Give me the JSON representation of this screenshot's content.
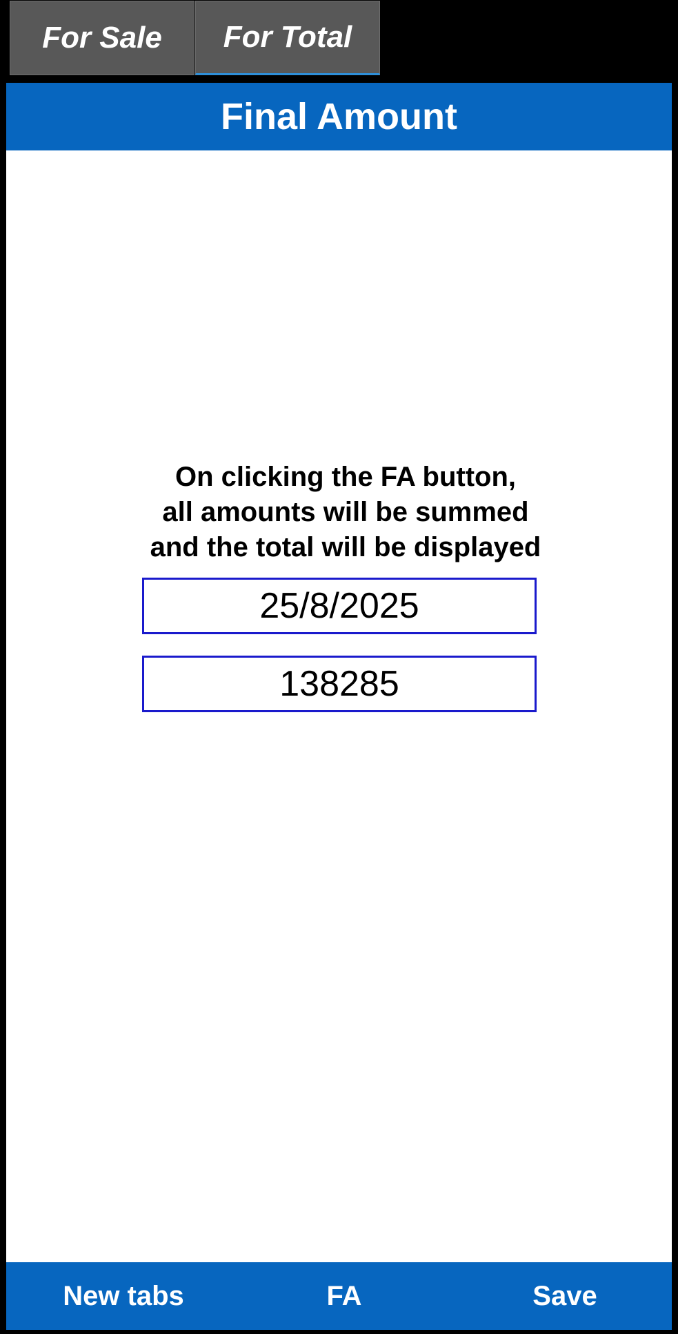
{
  "tabs": [
    {
      "label": "For Sale"
    },
    {
      "label": "For Total"
    }
  ],
  "header": {
    "title": "Final Amount"
  },
  "instructions": {
    "lines": [
      "On clicking the FA button,",
      "all amounts will be summed",
      "and the total will be displayed"
    ]
  },
  "fields": {
    "date_value": "25/8/2025",
    "total_value": "138285"
  },
  "footer": {
    "new_tabs_label": "New tabs",
    "fa_label": "FA",
    "save_label": "Save"
  },
  "colors": {
    "accent_blue": "#0766bf",
    "field_border": "#1a1acc",
    "tab_background": "#585858",
    "selected_tab_underline": "#2f8fd8"
  }
}
